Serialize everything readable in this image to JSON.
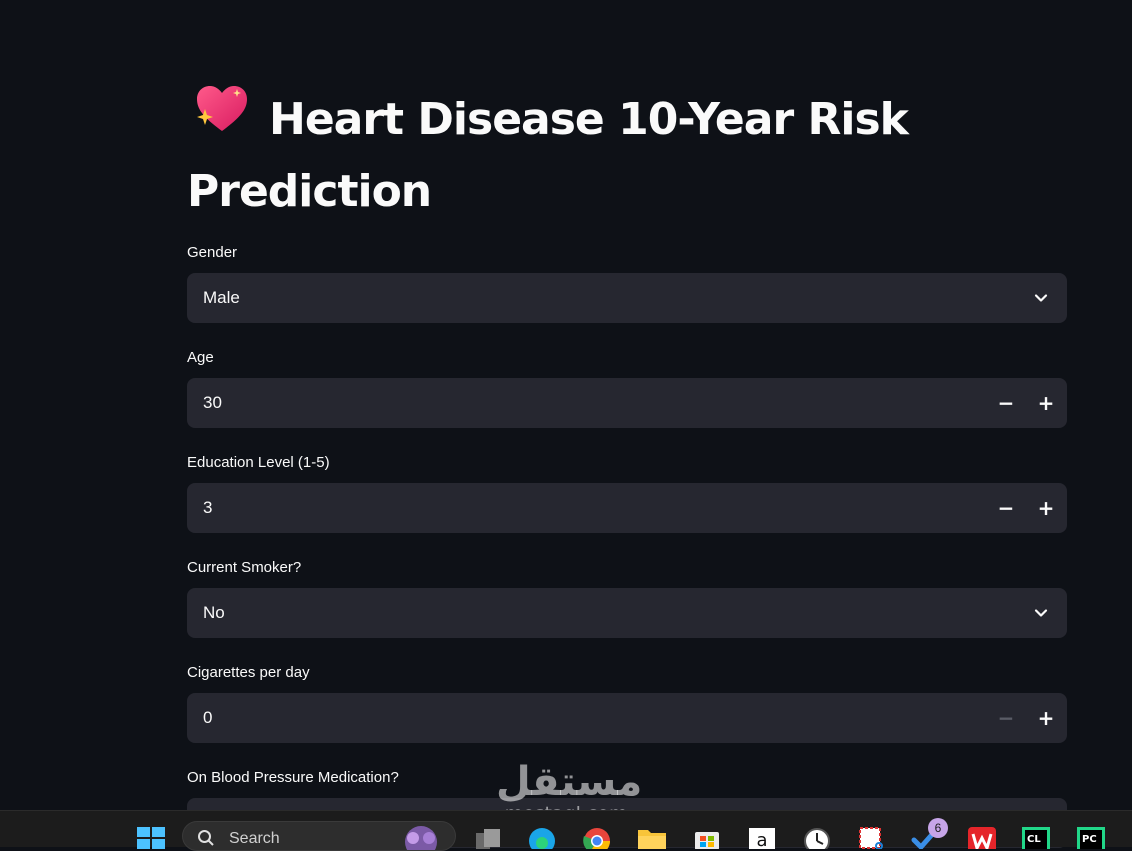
{
  "page": {
    "title": "Heart Disease 10-Year Risk Prediction"
  },
  "form": {
    "gender": {
      "label": "Gender",
      "value": "Male"
    },
    "age": {
      "label": "Age",
      "value": "30"
    },
    "education": {
      "label": "Education Level (1-5)",
      "value": "3"
    },
    "smoker": {
      "label": "Current Smoker?",
      "value": "No"
    },
    "cigs": {
      "label": "Cigarettes per day",
      "value": "0"
    },
    "bp_meds": {
      "label": "On Blood Pressure Medication?"
    }
  },
  "taskbar": {
    "search_label": "Search",
    "badge_count": "6",
    "icons": [
      "windows-start-icon",
      "search-icon",
      "task-view-icon",
      "edge-icon",
      "chrome-icon",
      "file-explorer-icon",
      "store-icon",
      "amazon-icon",
      "clock-icon",
      "snipping-tool-icon",
      "todo-icon",
      "wps-icon",
      "clion-icon",
      "pycharm-icon"
    ]
  },
  "watermark": {
    "arabic": "مستقل",
    "latin": "mostaql.com"
  },
  "colors": {
    "background": "#0e1117",
    "widget": "#262730",
    "text": "#fafafa",
    "taskbar": "#1c1c1c"
  }
}
